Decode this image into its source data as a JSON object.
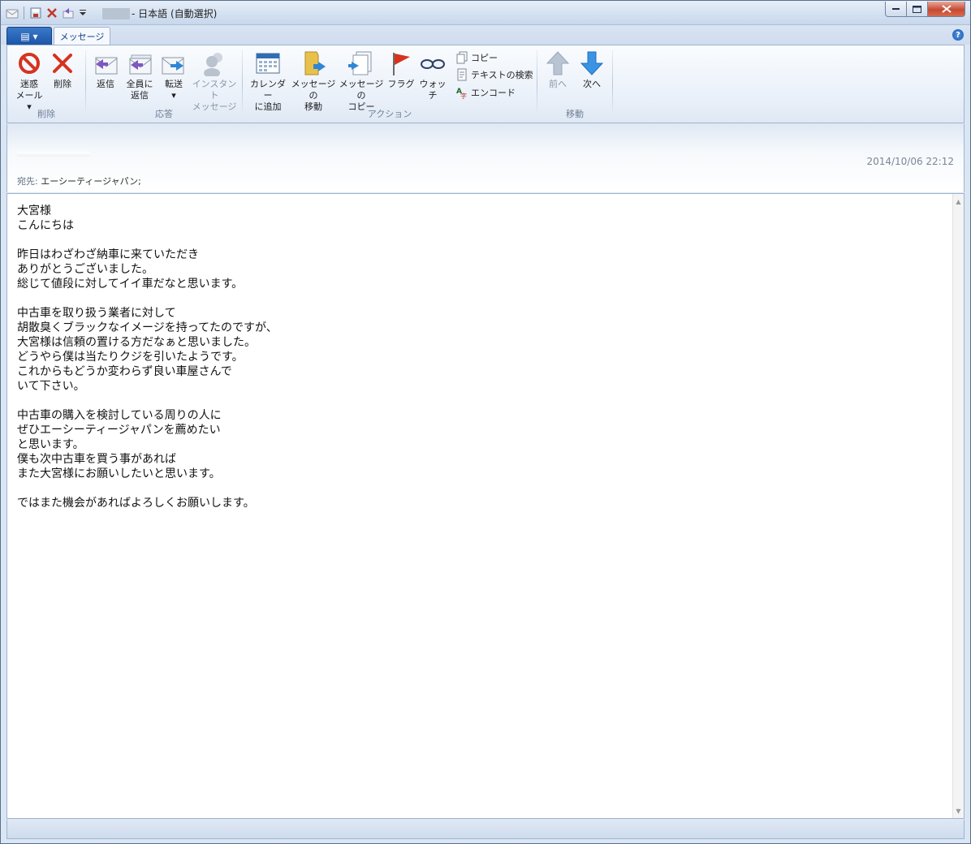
{
  "window": {
    "title_suffix": "- 日本語 (自動選択)",
    "buttons": {
      "minimize": "−",
      "maximize": "□",
      "close": "✕"
    }
  },
  "ribbon_tabs": {
    "app_menu_glyph": "▤ ▾",
    "message_tab": "メッセージ",
    "help": "?"
  },
  "ribbon": {
    "groups": {
      "delete": {
        "label": "削除",
        "junk": {
          "line1": "迷惑",
          "line2": "メール ▾"
        },
        "delete": "削除"
      },
      "respond": {
        "label": "応答",
        "reply": "返信",
        "reply_all": {
          "line1": "全員に",
          "line2": "返信"
        },
        "forward": {
          "line1": "転送",
          "line2": "▾"
        },
        "instant_message": {
          "line1": "インスタント",
          "line2": "メッセージ"
        }
      },
      "actions": {
        "label": "アクション",
        "add_calendar": {
          "line1": "カレンダー",
          "line2": "に追加"
        },
        "move_message": {
          "line1": "メッセージの",
          "line2": "移動"
        },
        "copy_message": {
          "line1": "メッセージの",
          "line2": "コピー"
        },
        "flag": "フラグ",
        "watch": "ウォッチ",
        "copy": "コピー",
        "find_text": "テキストの検索",
        "encode": "エンコード"
      },
      "navigate": {
        "label": "移動",
        "prev": "前へ",
        "next": "次へ"
      }
    }
  },
  "header": {
    "date": "2014/10/06 22:12",
    "to_label": "宛先:",
    "to_value": "エーシーティージャパン;"
  },
  "body": {
    "text": "大宮様\nこんにちは\n\n昨日はわざわざ納車に来ていただき\nありがとうございました。\n総じて値段に対してイイ車だなと思います。\n\n中古車を取り扱う業者に対して\n胡散臭くブラックなイメージを持ってたのですが、\n大宮様は信頼の置ける方だなぁと思いました。\nどうやら僕は当たりクジを引いたようです。\nこれからもどうか変わらず良い車屋さんで\nいて下さい。\n\n中古車の購入を検討している周りの人に\nぜひエーシーティージャパンを薦めたい\nと思います。\n僕も次中古車を買う事があれば\nまた大宮様にお願いしたいと思います。\n\nではまた機会があればよろしくお願いします。"
  },
  "scrollbar": {
    "up": "▲",
    "down": "▼"
  }
}
